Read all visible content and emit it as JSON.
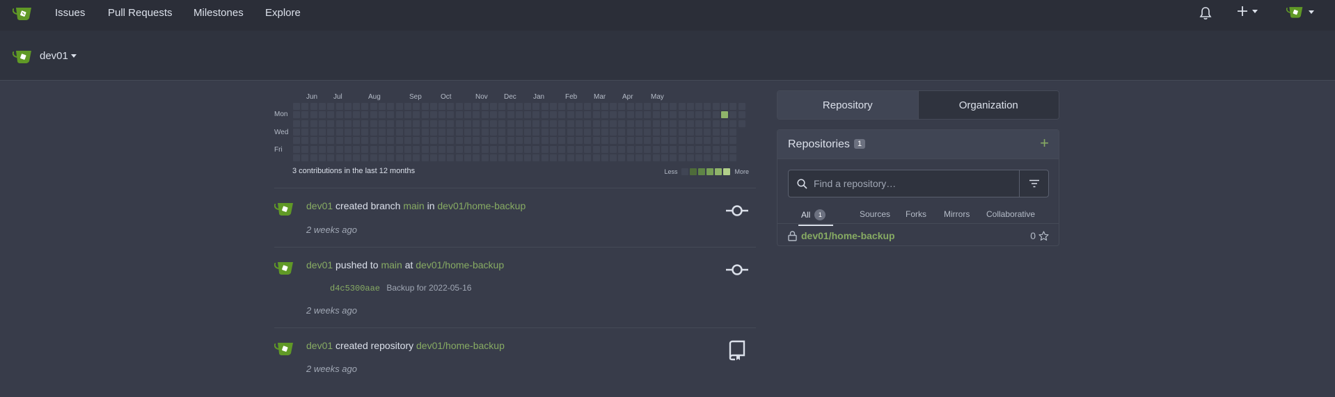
{
  "navbar": {
    "items": [
      "Issues",
      "Pull Requests",
      "Milestones",
      "Explore"
    ]
  },
  "context": {
    "name": "dev01"
  },
  "heatmap": {
    "months": [
      "Jun",
      "Jul",
      "Aug",
      "Sep",
      "Oct",
      "Nov",
      "Dec",
      "Jan",
      "Feb",
      "Mar",
      "Apr",
      "May"
    ],
    "days": [
      "Mon",
      "Wed",
      "Fri"
    ],
    "total_text": "3 contributions in the last 12 months",
    "legend_less": "Less",
    "legend_more": "More",
    "empty_color": "#404554",
    "legend_colors": [
      "#404554",
      "#4e6b3a",
      "#5f8546",
      "#78a057",
      "#8fb46a",
      "#b1cf8a"
    ],
    "active_color": "#8fb46a"
  },
  "feed": [
    {
      "user": "dev01",
      "action_pre": "created branch",
      "ref": "main",
      "joiner": "in",
      "repo": "dev01/home-backup",
      "time": "2 weeks ago",
      "icon": "commit-icon"
    },
    {
      "user": "dev01",
      "action_pre": "pushed to",
      "ref": "main",
      "joiner": "at",
      "repo": "dev01/home-backup",
      "commit_sha": "d4c5300aae",
      "commit_msg": "Backup for 2022-05-16",
      "time": "2 weeks ago",
      "icon": "commit-icon"
    },
    {
      "user": "dev01",
      "action_pre": "created repository",
      "repo": "dev01/home-backup",
      "time": "2 weeks ago",
      "icon": "repo-icon"
    }
  ],
  "panel": {
    "tabs": [
      "Repository",
      "Organization"
    ],
    "repos_title": "Repositories",
    "repos_count": "1",
    "search_placeholder": "Find a repository…",
    "subtabs": [
      "All",
      "Sources",
      "Forks",
      "Mirrors",
      "Collaborative"
    ],
    "all_count": "1",
    "repo_name": "dev01/home-backup",
    "repo_stars": "0"
  },
  "colors": {
    "accent": "#87ab63",
    "navbar_bg": "#2b2e38",
    "page_bg": "#383c4a"
  }
}
